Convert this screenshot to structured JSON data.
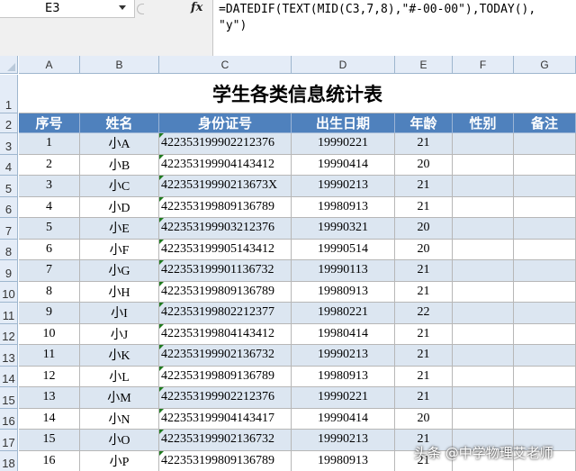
{
  "name_box": {
    "ref": "E3"
  },
  "formula_bar": {
    "fx_label": "fx",
    "formula": "=DATEDIF(TEXT(MID(C3,7,8),\"#-00-00\"),TODAY(),\n\"y\")"
  },
  "columns": [
    "A",
    "B",
    "C",
    "D",
    "E",
    "F",
    "G"
  ],
  "rows": [
    "1",
    "2",
    "3",
    "4",
    "5",
    "6",
    "7",
    "8",
    "9",
    "10",
    "11",
    "12",
    "13",
    "14",
    "15",
    "16",
    "17",
    "18"
  ],
  "sheet": {
    "title": "学生各类信息统计表",
    "headers": [
      "序号",
      "姓名",
      "身份证号",
      "出生日期",
      "年龄",
      "性别",
      "备注"
    ],
    "records": [
      [
        "1",
        "小A",
        "422353199902212376",
        "19990221",
        "21",
        "",
        ""
      ],
      [
        "2",
        "小B",
        "422353199904143412",
        "19990414",
        "20",
        "",
        ""
      ],
      [
        "3",
        "小C",
        "42235319990213673X",
        "19990213",
        "21",
        "",
        ""
      ],
      [
        "4",
        "小D",
        "422353199809136789",
        "19980913",
        "21",
        "",
        ""
      ],
      [
        "5",
        "小E",
        "422353199903212376",
        "19990321",
        "20",
        "",
        ""
      ],
      [
        "6",
        "小F",
        "422353199905143412",
        "19990514",
        "20",
        "",
        ""
      ],
      [
        "7",
        "小G",
        "422353199901136732",
        "19990113",
        "21",
        "",
        ""
      ],
      [
        "8",
        "小H",
        "422353199809136789",
        "19980913",
        "21",
        "",
        ""
      ],
      [
        "9",
        "小I",
        "422353199802212377",
        "19980221",
        "22",
        "",
        ""
      ],
      [
        "10",
        "小J",
        "422353199804143412",
        "19980414",
        "21",
        "",
        ""
      ],
      [
        "11",
        "小K",
        "422353199902136732",
        "19990213",
        "21",
        "",
        ""
      ],
      [
        "12",
        "小L",
        "422353199809136789",
        "19980913",
        "21",
        "",
        ""
      ],
      [
        "13",
        "小M",
        "422353199902212376",
        "19990221",
        "21",
        "",
        ""
      ],
      [
        "14",
        "小N",
        "422353199904143417",
        "19990414",
        "20",
        "",
        ""
      ],
      [
        "15",
        "小O",
        "422353199902136732",
        "19990213",
        "21",
        "",
        ""
      ],
      [
        "16",
        "小P",
        "422353199809136789",
        "19980913",
        "21",
        "",
        ""
      ]
    ]
  },
  "watermark": "头条 @中学物理艾老师",
  "colors": {
    "header_fill": "#4f81bd",
    "band_fill": "#dce6f1",
    "grid_header": "#e4ecf7"
  }
}
